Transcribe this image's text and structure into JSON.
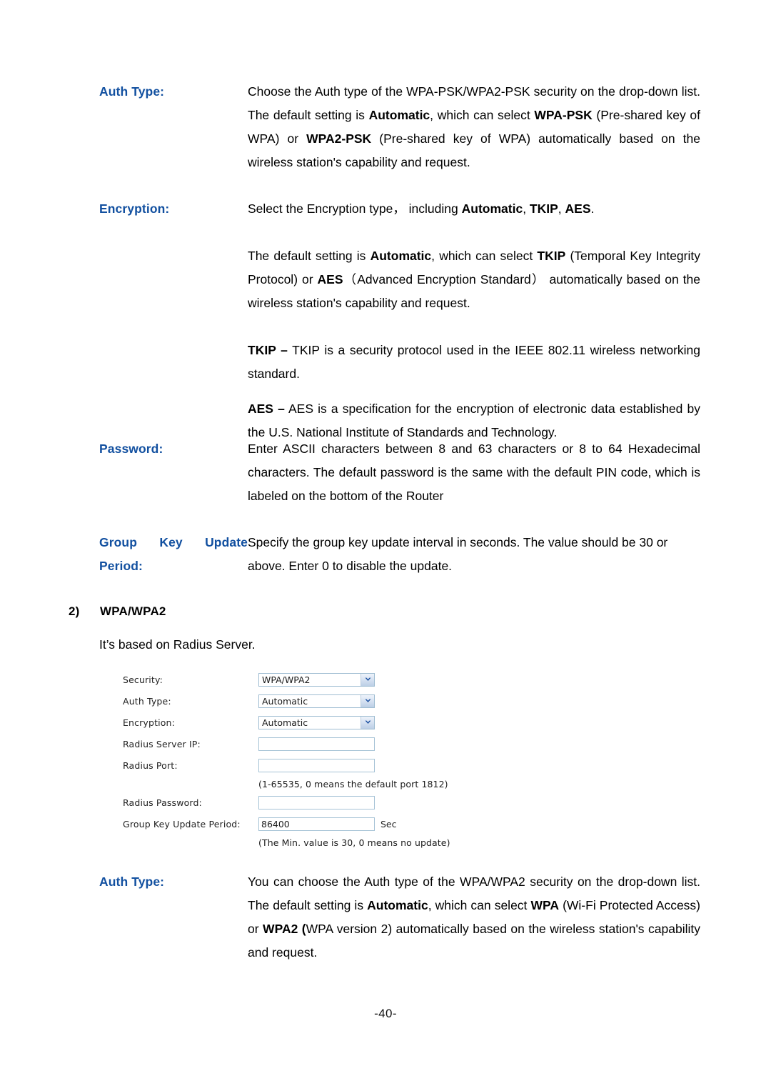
{
  "theme": {
    "term_color": "#1250a0",
    "body_color": "#000000",
    "field_border": "#a6c3d6",
    "select_border": "#9fbdd2",
    "arrow_fill": "#1a4fa0"
  },
  "sections": [
    {
      "term": "Auth Type:",
      "paragraphs": [
        {
          "runs": [
            {
              "t": "Choose the Auth type of the WPA-PSK/WPA2-PSK security on the drop-down list. The default setting is "
            },
            {
              "t": "Automatic",
              "b": true
            },
            {
              "t": ", which can select "
            },
            {
              "t": "WPA-PSK",
              "b": true
            },
            {
              "t": " (Pre-shared key of WPA) or "
            },
            {
              "t": "WPA2-PSK",
              "b": true
            },
            {
              "t": " (Pre-shared key of WPA) automatically based on the wireless station's capability and request."
            }
          ]
        }
      ]
    },
    {
      "term": "Encryption:",
      "paragraphs": [
        {
          "justify": false,
          "runs": [
            {
              "t": "Select the Encryption type，  including "
            },
            {
              "t": "Automatic",
              "b": true
            },
            {
              "t": ", "
            },
            {
              "t": "TKIP",
              "b": true
            },
            {
              "t": ", "
            },
            {
              "t": "AES",
              "b": true
            },
            {
              "t": "."
            }
          ]
        },
        {
          "runs": [
            {
              "t": "The default setting is "
            },
            {
              "t": "Automatic",
              "b": true
            },
            {
              "t": ", which can select "
            },
            {
              "t": "TKIP",
              "b": true
            },
            {
              "t": " (Temporal Key Integrity Protocol) or "
            },
            {
              "t": "AES",
              "b": true
            },
            {
              "t": "（Advanced Encryption Standard） automatically based on the wireless station's capability and request."
            }
          ]
        },
        {
          "runs": [
            {
              "t": "TKIP –",
              "b": true
            },
            {
              "t": " TKIP is a security protocol used in the IEEE 802.11 wireless networking standard."
            }
          ]
        },
        {
          "runs": [
            {
              "t": "AES –",
              "b": true
            },
            {
              "t": " AES is a specification for the encryption of electronic data established by the U.S. National Institute of Standards and Technology."
            }
          ]
        }
      ]
    },
    {
      "term": "Password:",
      "paragraphs": [
        {
          "runs": [
            {
              "t": "Enter ASCII characters between 8 and 63 characters or 8 to 64 Hexadecimal characters. The default password is the same with the default PIN code, which is labeled on the bottom of the Router"
            }
          ]
        }
      ]
    },
    {
      "term_words": [
        "Group",
        "Key",
        "Update",
        "Period:"
      ],
      "paragraphs": [
        {
          "runs": [
            {
              "t": "Specify the group key update interval in seconds. The value should be 30 or above. Enter 0 to disable the update."
            }
          ]
        }
      ]
    }
  ],
  "numbered_heading": {
    "number": "2)",
    "label": "WPA/WPA2"
  },
  "sub_note": "It’s based on Radius Server.",
  "router_form": {
    "rows": [
      {
        "label": "Security:",
        "control": "select",
        "value": "WPA/WPA2"
      },
      {
        "label": "Auth Type:",
        "control": "select",
        "value": "Automatic"
      },
      {
        "label": "Encryption:",
        "control": "select",
        "value": "Automatic"
      },
      {
        "label": "Radius Server IP:",
        "control": "input",
        "value": ""
      },
      {
        "label": "Radius Port:",
        "control": "input",
        "value": "",
        "hint": "(1-65535, 0 means the default port 1812)"
      },
      {
        "label": "Radius Password:",
        "control": "input",
        "value": ""
      },
      {
        "label": "Group Key Update Period:",
        "control": "input",
        "value": "86400",
        "unit": "Sec",
        "hint": "(The Min. value is 30, 0 means no update)"
      }
    ]
  },
  "bottom_section": {
    "term": "Auth Type:",
    "paragraphs": [
      {
        "runs": [
          {
            "t": "You can choose the Auth type of the WPA/WPA2 security on the drop-down list. The default setting is "
          },
          {
            "t": "Automatic",
            "b": true
          },
          {
            "t": ", which can select "
          },
          {
            "t": "WPA",
            "b": true
          },
          {
            "t": " (Wi-Fi Protected Access) or "
          },
          {
            "t": "WPA2 (",
            "b": true
          },
          {
            "t": "WPA version 2) automatically based on the wireless station's capability and request."
          }
        ]
      }
    ]
  },
  "footer": {
    "page_number": "-40-"
  }
}
